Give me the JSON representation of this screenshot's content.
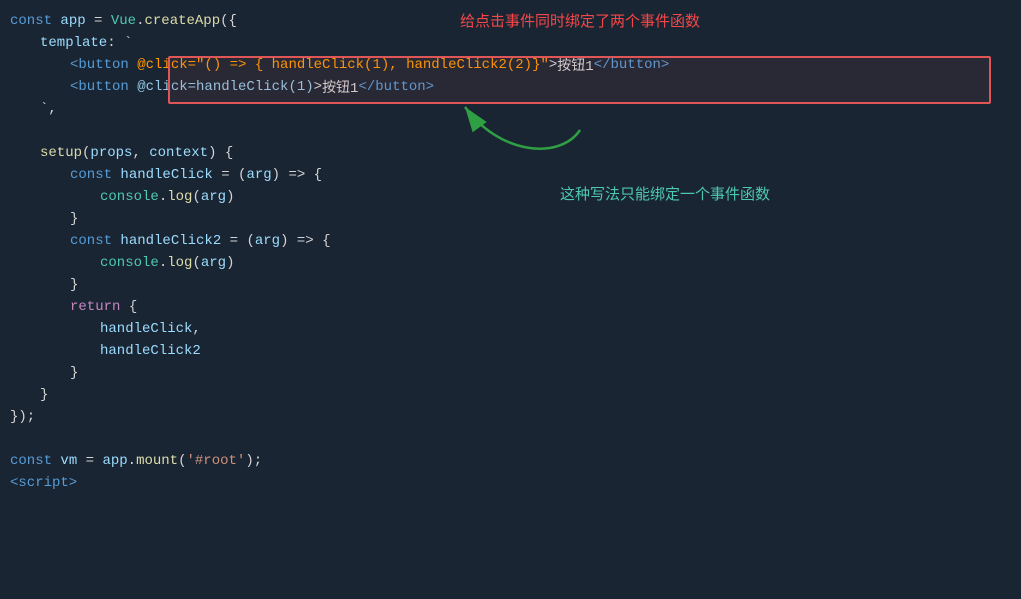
{
  "code": {
    "line1": "const app = Vue.createApp({",
    "line2": "    template: `",
    "line3_pre": "        <button ",
    "line3_attr": "@click=\"() => { handleClick(1), handleClick2(2)}\"",
    "line3_post": ">按钮1</button>",
    "line4_pre": "        <button ",
    "line4_attr": "@click=handleClick(1)",
    "line4_post": ">按钮1</button>",
    "line5": "    `,",
    "line6": "",
    "line7": "    setup(props, context) {",
    "line8": "        const handleClick = (arg) => {",
    "line9": "            console.log(arg)",
    "line10": "        }",
    "line11": "        const handleClick2 = (arg) => {",
    "line12": "            console.log(arg)",
    "line13": "        }",
    "line14": "        return {",
    "line15": "            handleClick,",
    "line16": "            handleClick2",
    "line17": "        }",
    "line18": "    }",
    "line19": "});",
    "line20": "",
    "line21": "const vm = app.mount('#root');",
    "line22": "<script>"
  },
  "annotations": {
    "top": "给点击事件同时绑定了两个事件函数",
    "bottom": "这种写法只能绑定一个事件函数"
  }
}
